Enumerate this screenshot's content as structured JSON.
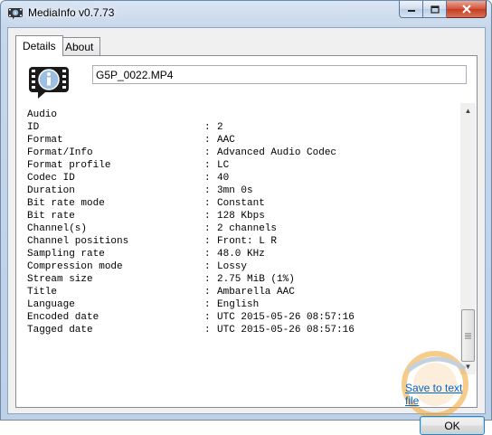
{
  "window": {
    "title": "MediaInfo v0.7.73",
    "controls": {
      "minimize": "minimize",
      "maximize": "maximize",
      "close": "close"
    }
  },
  "tabs": [
    {
      "label": "Details",
      "active": true
    },
    {
      "label": "About",
      "active": false
    }
  ],
  "file": {
    "name": "G5P_0022.MP4"
  },
  "info": {
    "section": "Audio",
    "rows": [
      {
        "key": "ID",
        "value": "2"
      },
      {
        "key": "Format",
        "value": "AAC"
      },
      {
        "key": "Format/Info",
        "value": "Advanced Audio Codec"
      },
      {
        "key": "Format profile",
        "value": "LC"
      },
      {
        "key": "Codec ID",
        "value": "40"
      },
      {
        "key": "Duration",
        "value": "3mn 0s"
      },
      {
        "key": "Bit rate mode",
        "value": "Constant"
      },
      {
        "key": "Bit rate",
        "value": "128 Kbps"
      },
      {
        "key": "Channel(s)",
        "value": "2 channels"
      },
      {
        "key": "Channel positions",
        "value": "Front: L R"
      },
      {
        "key": "Sampling rate",
        "value": "48.0 KHz"
      },
      {
        "key": "Compression mode",
        "value": "Lossy"
      },
      {
        "key": "Stream size",
        "value": "2.75 MiB (1%)"
      },
      {
        "key": "Title",
        "value": "Ambarella AAC"
      },
      {
        "key": "Language",
        "value": "English"
      },
      {
        "key": "Encoded date",
        "value": "UTC 2015-05-26 08:57:16"
      },
      {
        "key": "Tagged date",
        "value": "UTC 2015-05-26 08:57:16"
      }
    ],
    "separator": ":"
  },
  "actions": {
    "save": "Save to text file",
    "ok": "OK"
  },
  "icons": {
    "app": "mediainfo-app-icon",
    "logo": "mediainfo-film-info-icon"
  },
  "colors": {
    "link": "#0066cc",
    "ok_border": "#3c7fb1",
    "close_btn": "#c43c22"
  }
}
